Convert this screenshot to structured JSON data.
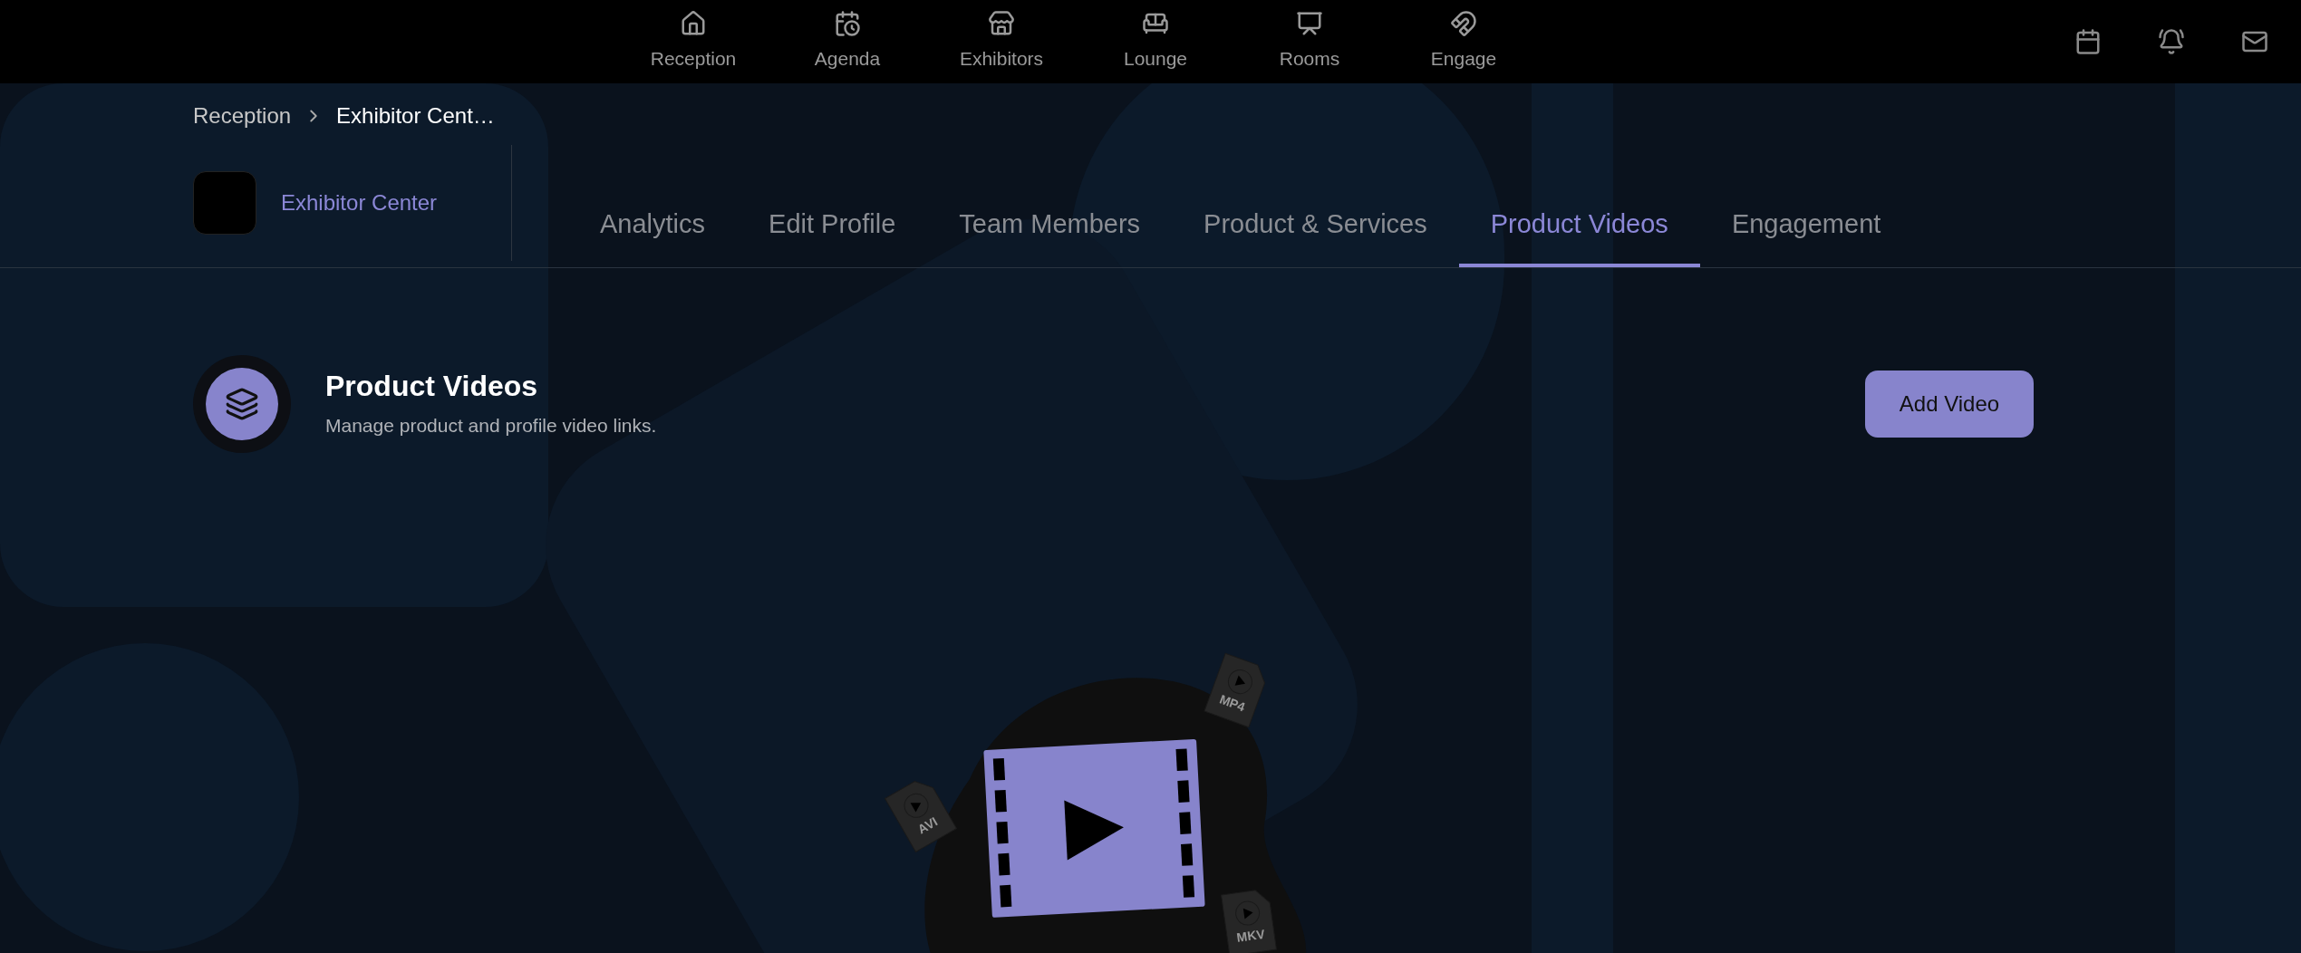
{
  "top_nav": {
    "items": [
      {
        "label": "Reception"
      },
      {
        "label": "Agenda"
      },
      {
        "label": "Exhibitors"
      },
      {
        "label": "Lounge"
      },
      {
        "label": "Rooms"
      },
      {
        "label": "Engage"
      }
    ]
  },
  "breadcrumb": [
    "Reception",
    "Exhibitor Cent…"
  ],
  "exhibitor": {
    "name": "Exhibitor Center"
  },
  "tabs": [
    {
      "label": "Analytics",
      "selected": false
    },
    {
      "label": "Edit Profile",
      "selected": false
    },
    {
      "label": "Team Members",
      "selected": false
    },
    {
      "label": "Product & Services",
      "selected": false
    },
    {
      "label": "Product Videos",
      "selected": true
    },
    {
      "label": "Engagement",
      "selected": false
    }
  ],
  "section": {
    "title": "Product Videos",
    "subtitle": "Manage product and profile video links.",
    "button": "Add Video"
  },
  "illustration": {
    "file_labels": [
      "AVI",
      "MP4",
      "MKV"
    ]
  }
}
